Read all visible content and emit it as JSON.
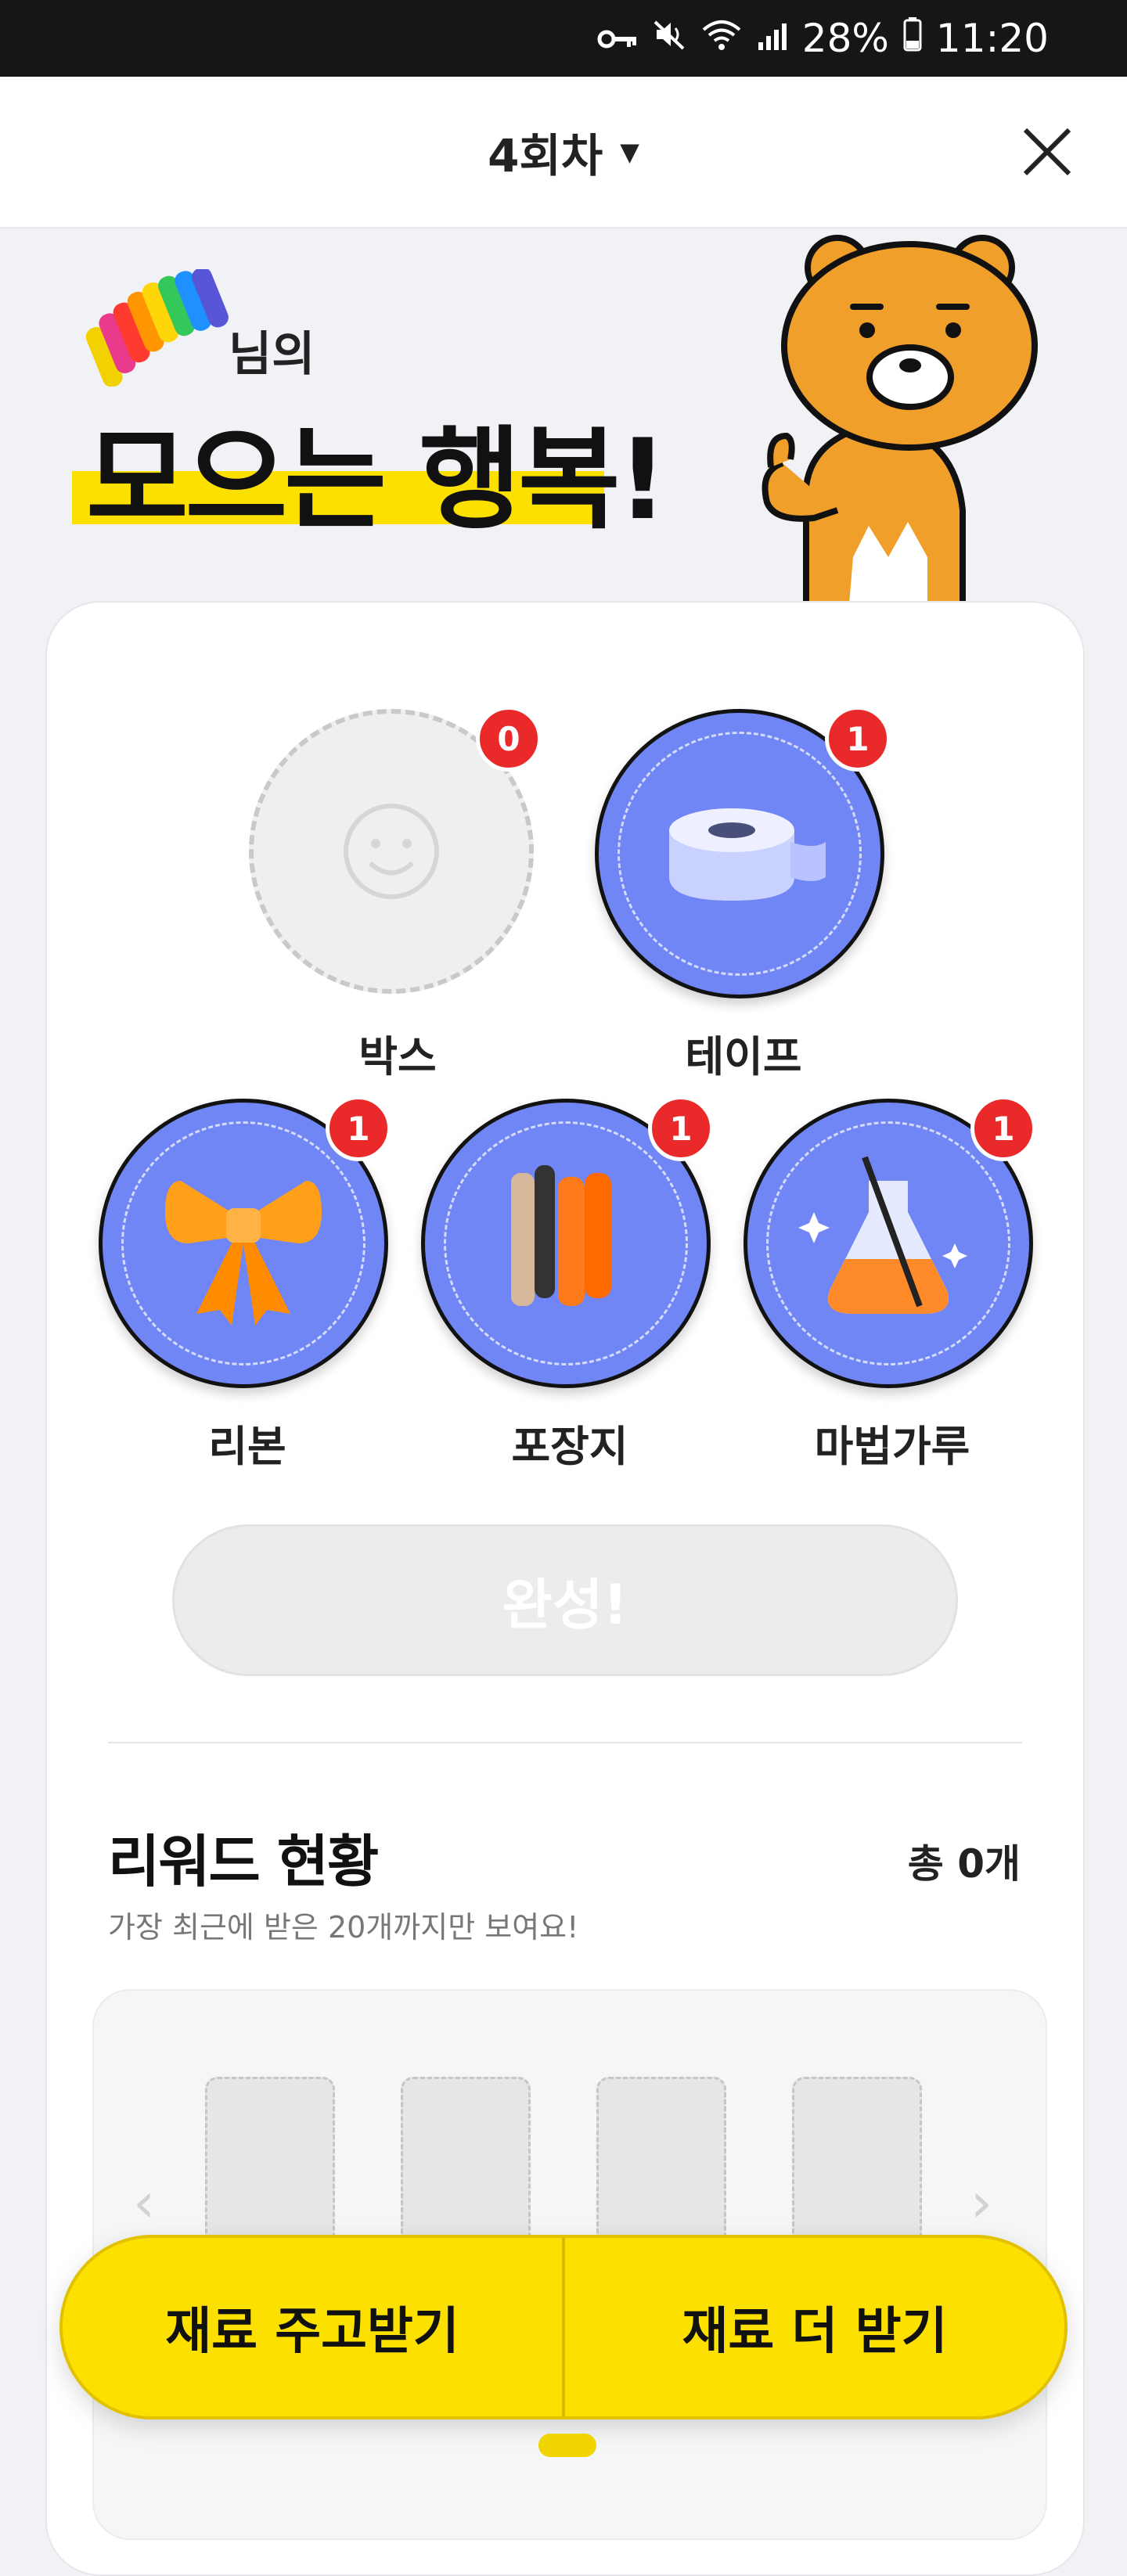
{
  "status_bar": {
    "battery": "28%",
    "time": "11:20"
  },
  "header": {
    "title": "4회차",
    "dropdown_icon": "caret-down-icon",
    "close_icon": "close-icon"
  },
  "banner": {
    "nickname_suffix": "님의",
    "title": "모으는 행복!"
  },
  "materials": [
    {
      "label": "박스",
      "count": "0",
      "collected": false
    },
    {
      "label": "테이프",
      "count": "1",
      "collected": true
    },
    {
      "label": "리본",
      "count": "1",
      "collected": true
    },
    {
      "label": "포장지",
      "count": "1",
      "collected": true
    },
    {
      "label": "마법가루",
      "count": "1",
      "collected": true
    }
  ],
  "complete_button": "완성!",
  "rewards": {
    "title": "리워드 현황",
    "total": "총 0개",
    "subtitle": "가장 최근에 받은 20개까지만 보여요!"
  },
  "actions": {
    "exchange": "재료 주고받기",
    "get_more": "재료 더 받기"
  },
  "colors": {
    "accent_yellow": "#fbe000",
    "badge_red": "#ea2a2a",
    "circle_blue": "#6f86f4"
  }
}
